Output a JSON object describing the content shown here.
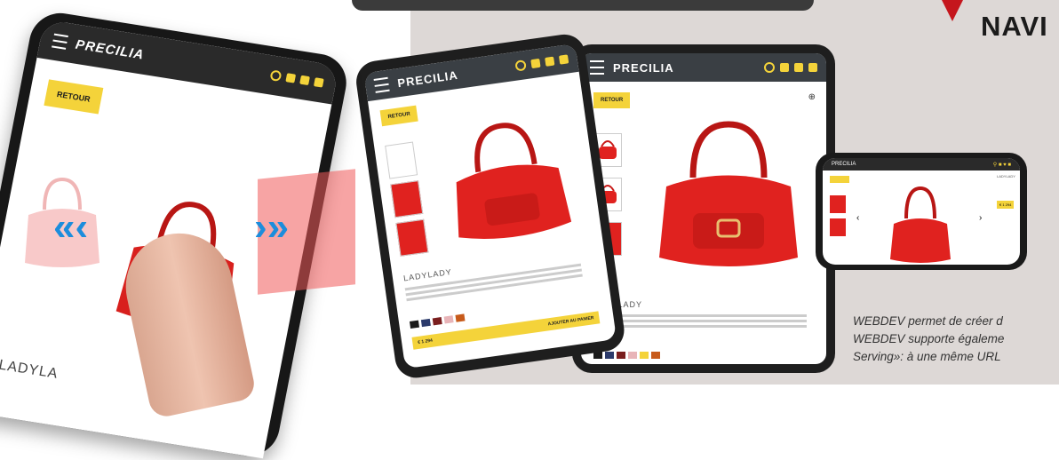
{
  "headline": {
    "title": "NAVI"
  },
  "caption": {
    "line1": "WEBDEV permet de créer d",
    "line2": "WEBDEV supporte égaleme",
    "line3": "Serving»: à une même URL"
  },
  "phone": {
    "brand": "PRECILIA",
    "back_button": "RETOUR",
    "product_name": "LADYLA"
  },
  "tablet_small": {
    "brand": "PRECILIA",
    "back_button": "RETOUR",
    "product_name": "LADYLADY",
    "price": "€ 1 294",
    "add_to_cart": "AJOUTER AU PANIER"
  },
  "tablet_large": {
    "brand": "PRECILIA",
    "back_button": "RETOUR",
    "product_name": "LADYLADY"
  },
  "phone_landscape": {
    "brand": "PRECILIA",
    "product_name": "LADYLADY",
    "price": "€ 1 294"
  },
  "colors": {
    "accent_yellow": "#f4d33a",
    "brand_red": "#c5161d",
    "bag_red": "#e0221f",
    "swipe_blue": "#1c8ddc",
    "swatches": [
      "#1b1b1b",
      "#2b3a6b",
      "#7a1e1e",
      "#e8b4b8",
      "#f4d33a",
      "#c75a1b"
    ]
  }
}
